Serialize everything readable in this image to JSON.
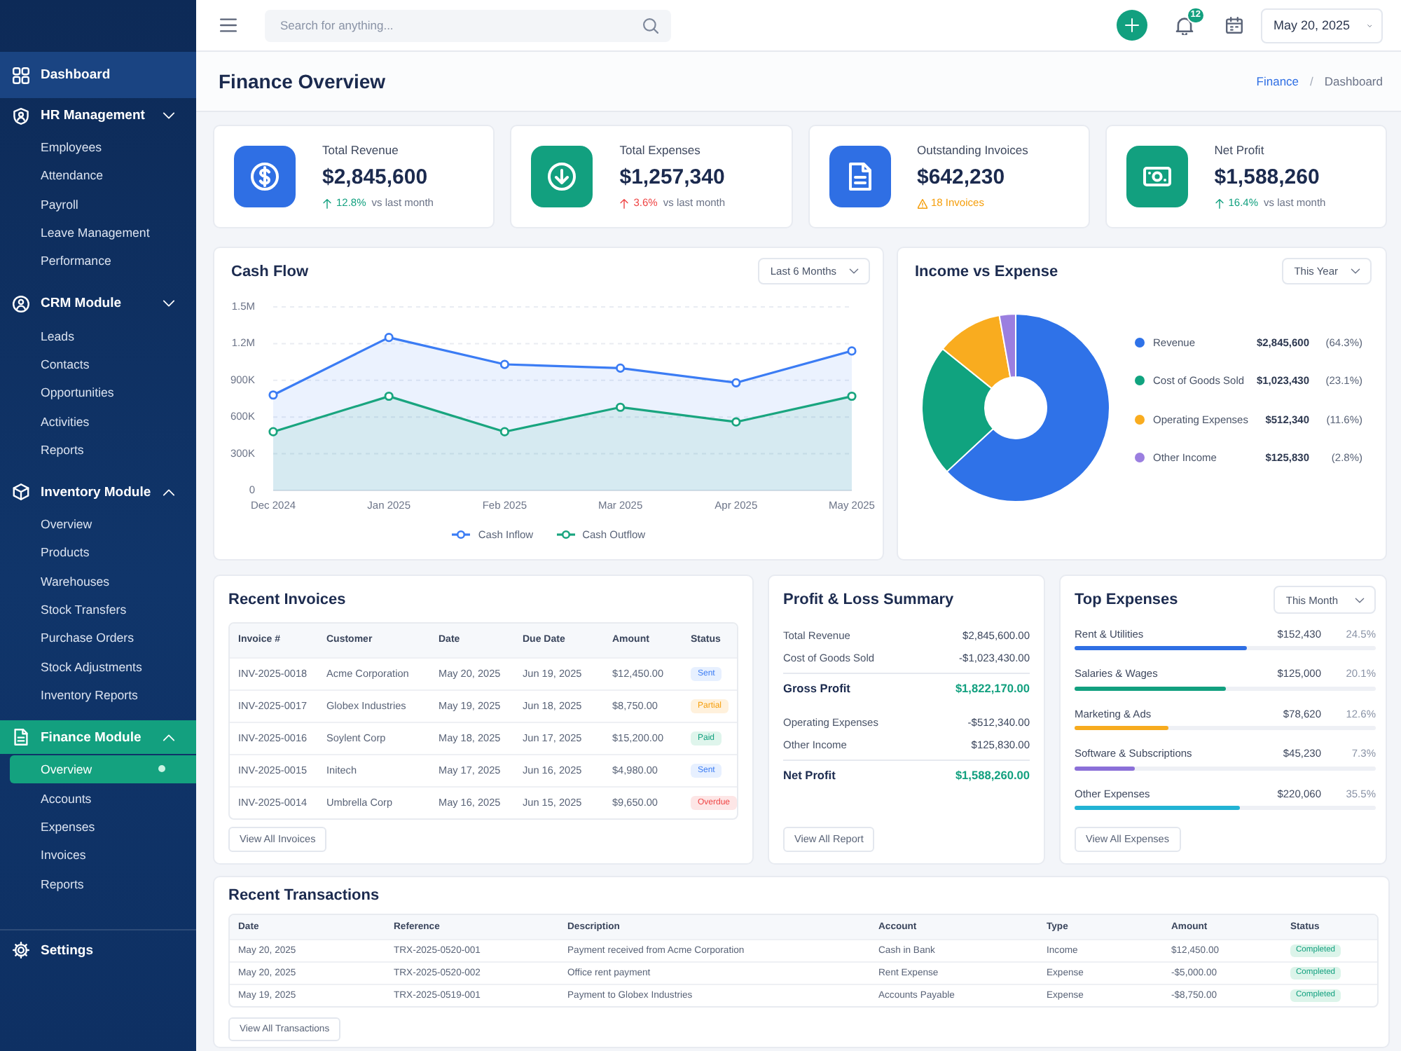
{
  "sidebar": {
    "items": [
      {
        "kind": "link",
        "label": "Dashboard",
        "highlighted": true
      },
      {
        "kind": "group",
        "label": "HR Management",
        "expanded": false,
        "active": false,
        "children": [
          {
            "label": "Employees",
            "selected": false
          },
          {
            "label": "Attendance",
            "selected": false
          },
          {
            "label": "Payroll",
            "selected": false
          },
          {
            "label": "Leave Management",
            "selected": false
          },
          {
            "label": "Performance",
            "selected": false
          }
        ]
      },
      {
        "kind": "group",
        "label": "CRM Module",
        "expanded": false,
        "active": false,
        "children": [
          {
            "label": "Leads",
            "selected": false
          },
          {
            "label": "Contacts",
            "selected": false
          },
          {
            "label": "Opportunities",
            "selected": false
          },
          {
            "label": "Activities",
            "selected": false
          },
          {
            "label": "Reports",
            "selected": false
          }
        ]
      },
      {
        "kind": "group",
        "label": "Inventory Module",
        "expanded": true,
        "active": false,
        "children": [
          {
            "label": "Overview",
            "selected": false
          },
          {
            "label": "Products",
            "selected": false
          },
          {
            "label": "Warehouses",
            "selected": false
          },
          {
            "label": "Stock Transfers",
            "selected": false
          },
          {
            "label": "Purchase Orders",
            "selected": false
          },
          {
            "label": "Stock Adjustments",
            "selected": false
          },
          {
            "label": "Inventory Reports",
            "selected": false
          }
        ]
      },
      {
        "kind": "group",
        "label": "Finance Module",
        "expanded": true,
        "active": true,
        "children": [
          {
            "label": "Overview",
            "selected": true
          },
          {
            "label": "Accounts",
            "selected": false
          },
          {
            "label": "Expenses",
            "selected": false
          },
          {
            "label": "Invoices",
            "selected": false
          },
          {
            "label": "Reports",
            "selected": false
          }
        ]
      },
      {
        "kind": "link",
        "label": "Settings",
        "highlighted": false
      }
    ]
  },
  "topbar": {
    "search": {
      "placeholder": "Search for anything..."
    },
    "notifications": "12",
    "date": "May 20, 2025"
  },
  "header": {
    "title": "Finance Overview",
    "breadcrumb": [
      {
        "label": "Finance",
        "link": true
      },
      {
        "label": "Dashboard",
        "link": false
      }
    ],
    "separator": "/"
  },
  "kpis": [
    {
      "kind": "rise_good",
      "label": "Total Revenue",
      "value": "$2,845,600",
      "color": "#2f6fe4",
      "sub": {
        "text": "12.8%",
        "note": "vs last month"
      }
    },
    {
      "kind": "rise_bad",
      "label": "Total Expenses",
      "value": "$1,257,340",
      "color": "#12a07f",
      "sub": {
        "text": "3.6%",
        "note": "vs last month"
      }
    },
    {
      "kind": "alert",
      "label": "Outstanding Invoices",
      "value": "$642,230",
      "color": "#2f6fe4",
      "sub": {
        "text": "18 Invoices"
      }
    },
    {
      "kind": "rise_good",
      "label": "Net Profit",
      "value": "$1,588,260",
      "color": "#12a07f",
      "sub": {
        "text": "16.4%",
        "note": "vs last month"
      }
    }
  ],
  "cash_flow": {
    "title": "Cash Flow",
    "period": "Last 6 Months",
    "chart_data": {
      "type": "area",
      "categories": [
        "Dec 2024",
        "Jan 2025",
        "Feb 2025",
        "Mar 2025",
        "Apr 2025",
        "May 2025"
      ],
      "series": [
        {
          "name": "Cash Inflow",
          "color": "#3b7cf4",
          "values": [
            780000,
            1250000,
            1030000,
            1000000,
            880000,
            1140000
          ]
        },
        {
          "name": "Cash Outflow",
          "color": "#19a57f",
          "values": [
            480000,
            770000,
            480000,
            680000,
            560000,
            770000
          ]
        }
      ],
      "ylim": [
        0,
        1500000
      ],
      "yticks": [
        {
          "value": 0,
          "label": "0"
        },
        {
          "value": 300000,
          "label": "300K"
        },
        {
          "value": 600000,
          "label": "600K"
        },
        {
          "value": 900000,
          "label": "900K"
        },
        {
          "value": 1200000,
          "label": "1.2M"
        },
        {
          "value": 1500000,
          "label": "1.5M"
        }
      ],
      "grid": true,
      "legend": "bottom"
    }
  },
  "income_vs_expense": {
    "title": "Income vs Expense",
    "period": "This Year",
    "chart_data": {
      "type": "donut",
      "categories": [
        "Revenue",
        "Cost of Goods Sold",
        "Operating Expenses",
        "Other Income"
      ],
      "values": [
        63.1,
        22.7,
        11.4,
        2.8
      ],
      "legend": "right"
    },
    "legend_rows": [
      {
        "amount": "$2,845,600",
        "percent": "(64.3%)",
        "color": "#2f72e8"
      },
      {
        "amount": "$1,023,430",
        "percent": "(23.1%)",
        "color": "#10a37f"
      },
      {
        "amount": "$512,340",
        "percent": "(11.6%)",
        "color": "#f9ac1f"
      },
      {
        "amount": "$125,830",
        "percent": "(2.8%)",
        "color": "#9b7fe0"
      }
    ]
  },
  "recent_invoices": {
    "title": "Recent Invoices",
    "columns": [
      "Invoice #",
      "Customer",
      "Date",
      "Due Date",
      "Amount",
      "Status"
    ],
    "rows": [
      {
        "cells": [
          "INV-2025-0018",
          "Acme Corporation",
          "May 20, 2025",
          "Jun 19, 2025",
          "$12,450.00"
        ],
        "status": {
          "label": "Sent",
          "kind": "sent"
        }
      },
      {
        "cells": [
          "INV-2025-0017",
          "Globex Industries",
          "May 19, 2025",
          "Jun 18, 2025",
          "$8,750.00"
        ],
        "status": {
          "label": "Partial",
          "kind": "partial"
        }
      },
      {
        "cells": [
          "INV-2025-0016",
          "Soylent Corp",
          "May 18, 2025",
          "Jun 17, 2025",
          "$15,200.00"
        ],
        "status": {
          "label": "Paid",
          "kind": "paid"
        }
      },
      {
        "cells": [
          "INV-2025-0015",
          "Initech",
          "May 17, 2025",
          "Jun 16, 2025",
          "$4,980.00"
        ],
        "status": {
          "label": "Sent",
          "kind": "sent"
        }
      },
      {
        "cells": [
          "INV-2025-0014",
          "Umbrella Corp",
          "May 16, 2025",
          "Jun 15, 2025",
          "$9,650.00"
        ],
        "status": {
          "label": "Overdue",
          "kind": "overdue"
        }
      }
    ],
    "button": "View All Invoices"
  },
  "profit_loss": {
    "title": "Profit & Loss Summary",
    "rows": [
      {
        "kind": "item",
        "label": "Total Revenue",
        "value": "$2,845,600.00"
      },
      {
        "kind": "item",
        "label": "Cost of Goods Sold",
        "value": "-$1,023,430.00"
      },
      {
        "kind": "total",
        "label": "Gross Profit",
        "value": "$1,822,170.00"
      },
      {
        "kind": "item",
        "label": "Operating Expenses",
        "value": "-$512,340.00"
      },
      {
        "kind": "item",
        "label": "Other Income",
        "value": "$125,830.00"
      },
      {
        "kind": "total",
        "label": "Net Profit",
        "value": "$1,588,260.00"
      }
    ],
    "button": "View All Report"
  },
  "top_expenses": {
    "title": "Top Expenses",
    "period": "This Month",
    "items": [
      {
        "label": "Rent & Utilities",
        "amount": "$152,430",
        "percent": "24.5%",
        "level": 0.57,
        "color": "#2f6fe4"
      },
      {
        "label": "Salaries & Wages",
        "amount": "$125,000",
        "percent": "20.1%",
        "level": 0.5,
        "color": "#12a07f"
      },
      {
        "label": "Marketing & Ads",
        "amount": "$78,620",
        "percent": "12.6%",
        "level": 0.31,
        "color": "#f7ab1e"
      },
      {
        "label": "Software & Subscriptions",
        "amount": "$45,230",
        "percent": "7.3%",
        "level": 0.2,
        "color": "#8b6fd8"
      },
      {
        "label": "Other Expenses",
        "amount": "$220,060",
        "percent": "35.5%",
        "level": 0.55,
        "color": "#22b3d4"
      }
    ],
    "button": "View All Expenses"
  },
  "recent_transactions": {
    "title": "Recent Transactions",
    "columns": [
      "Date",
      "Reference",
      "Description",
      "Account",
      "Type",
      "Amount",
      "Status"
    ],
    "rows": [
      {
        "cells": [
          "May 20, 2025",
          "TRX-2025-0520-001",
          "Payment received from Acme Corporation",
          "Cash in Bank",
          "Income",
          "$12,450.00"
        ],
        "status": {
          "label": "Completed",
          "kind": "completed"
        }
      },
      {
        "cells": [
          "May 20, 2025",
          "TRX-2025-0520-002",
          "Office rent payment",
          "Rent Expense",
          "Expense",
          "-$5,000.00"
        ],
        "status": {
          "label": "Completed",
          "kind": "completed"
        }
      },
      {
        "cells": [
          "May 19, 2025",
          "TRX-2025-0519-001",
          "Payment to Globex Industries",
          "Accounts Payable",
          "Expense",
          "-$8,750.00"
        ],
        "status": {
          "label": "Completed",
          "kind": "completed"
        }
      }
    ],
    "button": "View All Transactions"
  }
}
